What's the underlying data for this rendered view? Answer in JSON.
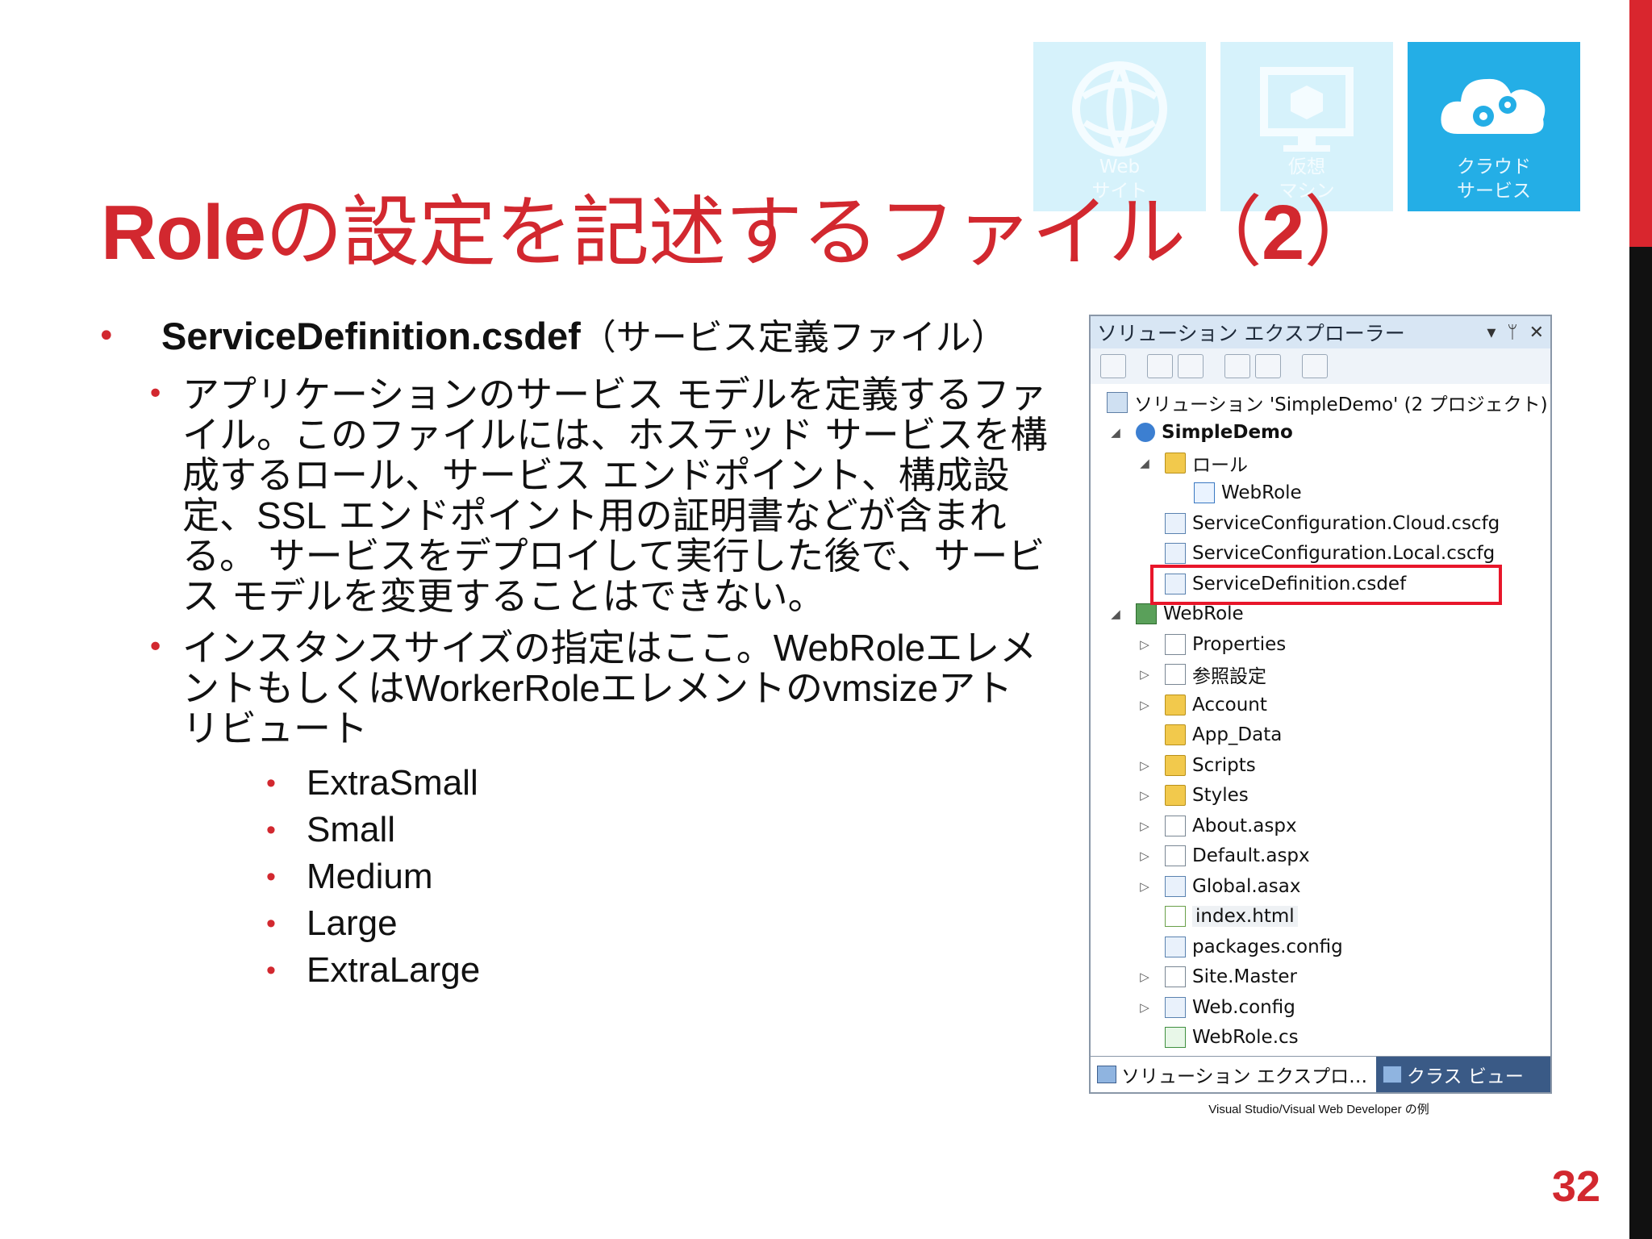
{
  "title": {
    "bold1": "Role",
    "rest": "の設定を記述するファイル（",
    "bold2": "2",
    "close": "）"
  },
  "tiles": [
    {
      "label": "Web\nサイト",
      "icon": "web-globe-icon",
      "state": "faded"
    },
    {
      "label": "仮想\nマシン",
      "icon": "monitor-cube-icon",
      "state": "faded"
    },
    {
      "label": "クラウド\nサービス",
      "icon": "cloud-gears-icon",
      "state": "active"
    }
  ],
  "main": {
    "bullet1_em": "ServiceDefinition.csdef",
    "bullet1_rest": "（サービス定義ファイル）",
    "sub1_a": "アプリケーションのサービス モデルを定義するファイル。このファイルには、ホステッド サービスを構成するロール、サービス エンドポイント、構成設定、",
    "sub1_lat": "SSL",
    "sub1_b": " エンドポイント用の証明書などが含まれる。 サービスをデプロイして実行した後で、サービス モデルを変更することはできない。",
    "sub2_a": "インスタンスサイズの指定はここ。",
    "sub2_lat1": "WebRole",
    "sub2_b": "エレメントもしくは",
    "sub2_lat2": "WorkerRole",
    "sub2_c": "エレメントの",
    "sub2_lat3": "vmsize",
    "sub2_d": "アトリビュート",
    "sizes": [
      "ExtraSmall",
      "Small",
      "Medium",
      "Large",
      "ExtraLarge"
    ]
  },
  "explorer": {
    "title": "ソリューション エクスプローラー",
    "controls": [
      "▾",
      "ᛘ",
      "✕"
    ],
    "items": [
      "ソリューション 'SimpleDemo' (2 プロジェクト)",
      "SimpleDemo",
      "ロール",
      "WebRole",
      "ServiceConfiguration.Cloud.cscfg",
      "ServiceConfiguration.Local.cscfg",
      "ServiceDefinition.csdef",
      "WebRole",
      "Properties",
      "参照設定",
      "Account",
      "App_Data",
      "Scripts",
      "Styles",
      "About.aspx",
      "Default.aspx",
      "Global.asax",
      "index.html",
      "packages.config",
      "Site.Master",
      "Web.config",
      "WebRole.cs"
    ],
    "tab1": "ソリューション エクスプロ…",
    "tab2": "クラス ビュー"
  },
  "caption": "Visual Studio/Visual Web Developer の例",
  "page_number": "32",
  "colors": {
    "accent": "#d2282f",
    "tile_active": "#24aee6",
    "tile_faded": "#d6f2fb",
    "highlight": "#e8162a"
  }
}
